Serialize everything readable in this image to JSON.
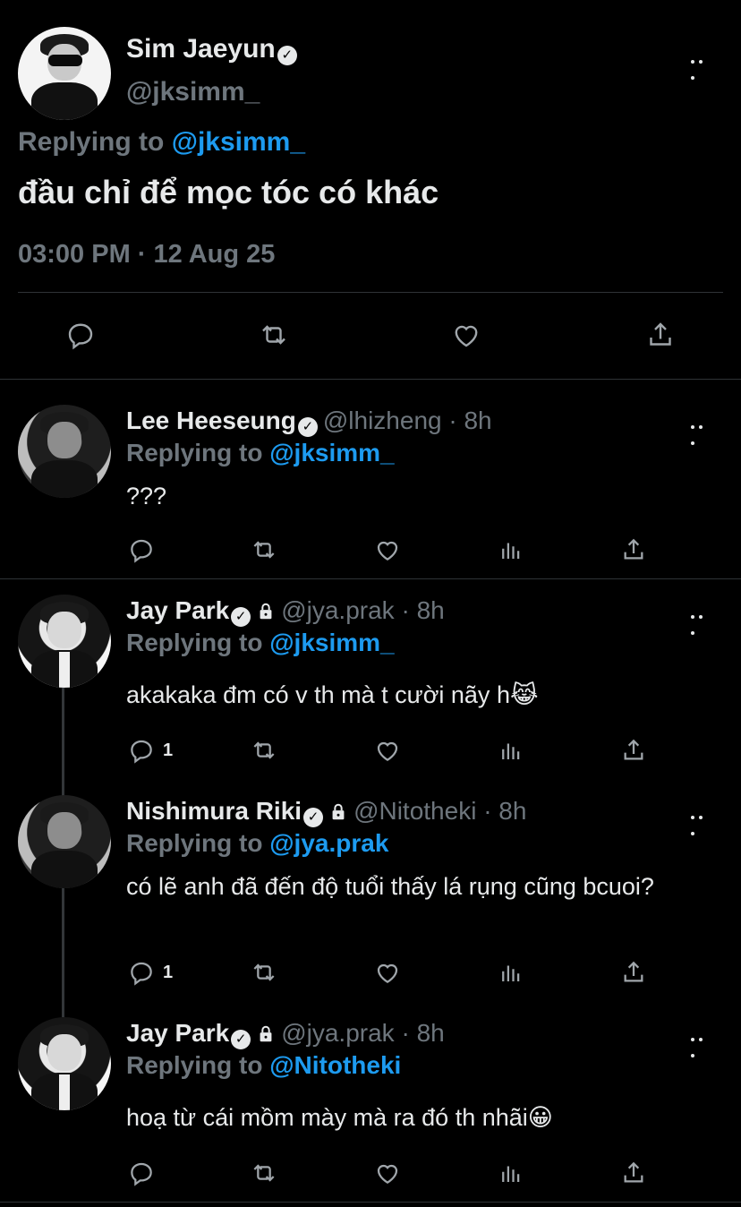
{
  "main_tweet": {
    "name": "Sim Jaeyun",
    "handle": "@jksimm_",
    "replying_prefix": "Replying to",
    "replying_to": "@jksimm_",
    "text": "đầu chỉ để mọc tóc có khác",
    "timestamp": "03:00 PM · 12 Aug 25"
  },
  "replies": [
    {
      "name": "Lee Heeseung",
      "meta": "@lhizheng · 8h",
      "replying_prefix": "Replying to",
      "replying_to": "@jksimm_",
      "text": "???",
      "reply_count": ""
    },
    {
      "name": "Jay Park",
      "meta": "@jya.prak · 8h",
      "replying_prefix": "Replying to",
      "replying_to": "@jksimm_",
      "text": "akakaka đm có v th mà t cười nãy h😹",
      "reply_count": "1"
    },
    {
      "name": "Nishimura Riki",
      "meta": "@Nitotheki · 8h",
      "replying_prefix": "Replying to",
      "replying_to": "@jya.prak",
      "text": "có lẽ anh đã đến độ tuổi thấy lá rụng cũng bcuoi?",
      "reply_count": "1"
    },
    {
      "name": "Jay Park",
      "meta": "@jya.prak · 8h",
      "replying_prefix": "Replying to",
      "replying_to": "@Nitotheki",
      "text": "hoạ từ cái mồm mày mà ra đó th nhãi😀",
      "reply_count": ""
    }
  ],
  "icons": {
    "reply": "reply-icon",
    "retweet": "retweet-icon",
    "like": "heart-icon",
    "analytics": "analytics-icon",
    "share": "share-icon",
    "more": "more-icon",
    "verified": "verified-icon",
    "lock": "lock-icon"
  },
  "colors": {
    "background": "#000000",
    "text": "#e7e9ea",
    "secondary": "#6e767d",
    "accent": "#1d9bf0",
    "divider": "#2f3336"
  }
}
